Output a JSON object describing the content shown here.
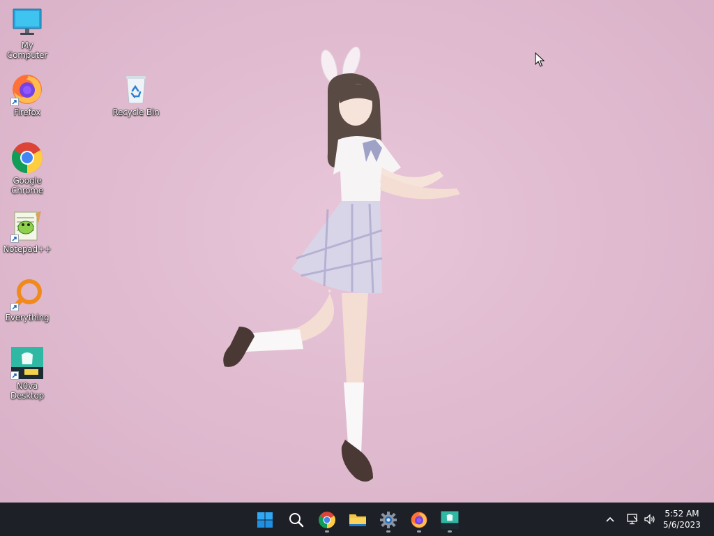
{
  "desktop": {
    "icons": [
      {
        "label": "My Computer",
        "icon": "monitor-icon"
      },
      {
        "label": "Firefox",
        "icon": "firefox-icon"
      },
      {
        "label": "Recycle Bin",
        "icon": "recycle-bin-icon"
      },
      {
        "label": "Google Chrome",
        "icon": "chrome-icon"
      },
      {
        "label": "Notepad++",
        "icon": "notepadpp-icon"
      },
      {
        "label": "Everything",
        "icon": "everything-search-icon"
      },
      {
        "label": "N0va Desktop",
        "icon": "nova-desktop-icon"
      }
    ]
  },
  "taskbar": {
    "buttons": [
      {
        "name": "start",
        "icon": "windows-logo-icon"
      },
      {
        "name": "search",
        "icon": "search-icon"
      },
      {
        "name": "chrome",
        "icon": "chrome-icon",
        "running": true
      },
      {
        "name": "file-explorer",
        "icon": "folder-icon",
        "running": false
      },
      {
        "name": "settings",
        "icon": "gear-icon",
        "running": true
      },
      {
        "name": "firefox",
        "icon": "firefox-icon",
        "running": true
      },
      {
        "name": "nova-desktop",
        "icon": "nova-desktop-icon",
        "running": true
      }
    ],
    "tray": {
      "icons": [
        "chevron-up-icon",
        "network-icon",
        "volume-icon"
      ]
    },
    "clock": {
      "time": "5:52 AM",
      "date": "5/6/2023"
    }
  },
  "colors": {
    "wallpaper": "#dfb9ce",
    "taskbar": "#1d2027",
    "accent": "#0078d4"
  }
}
